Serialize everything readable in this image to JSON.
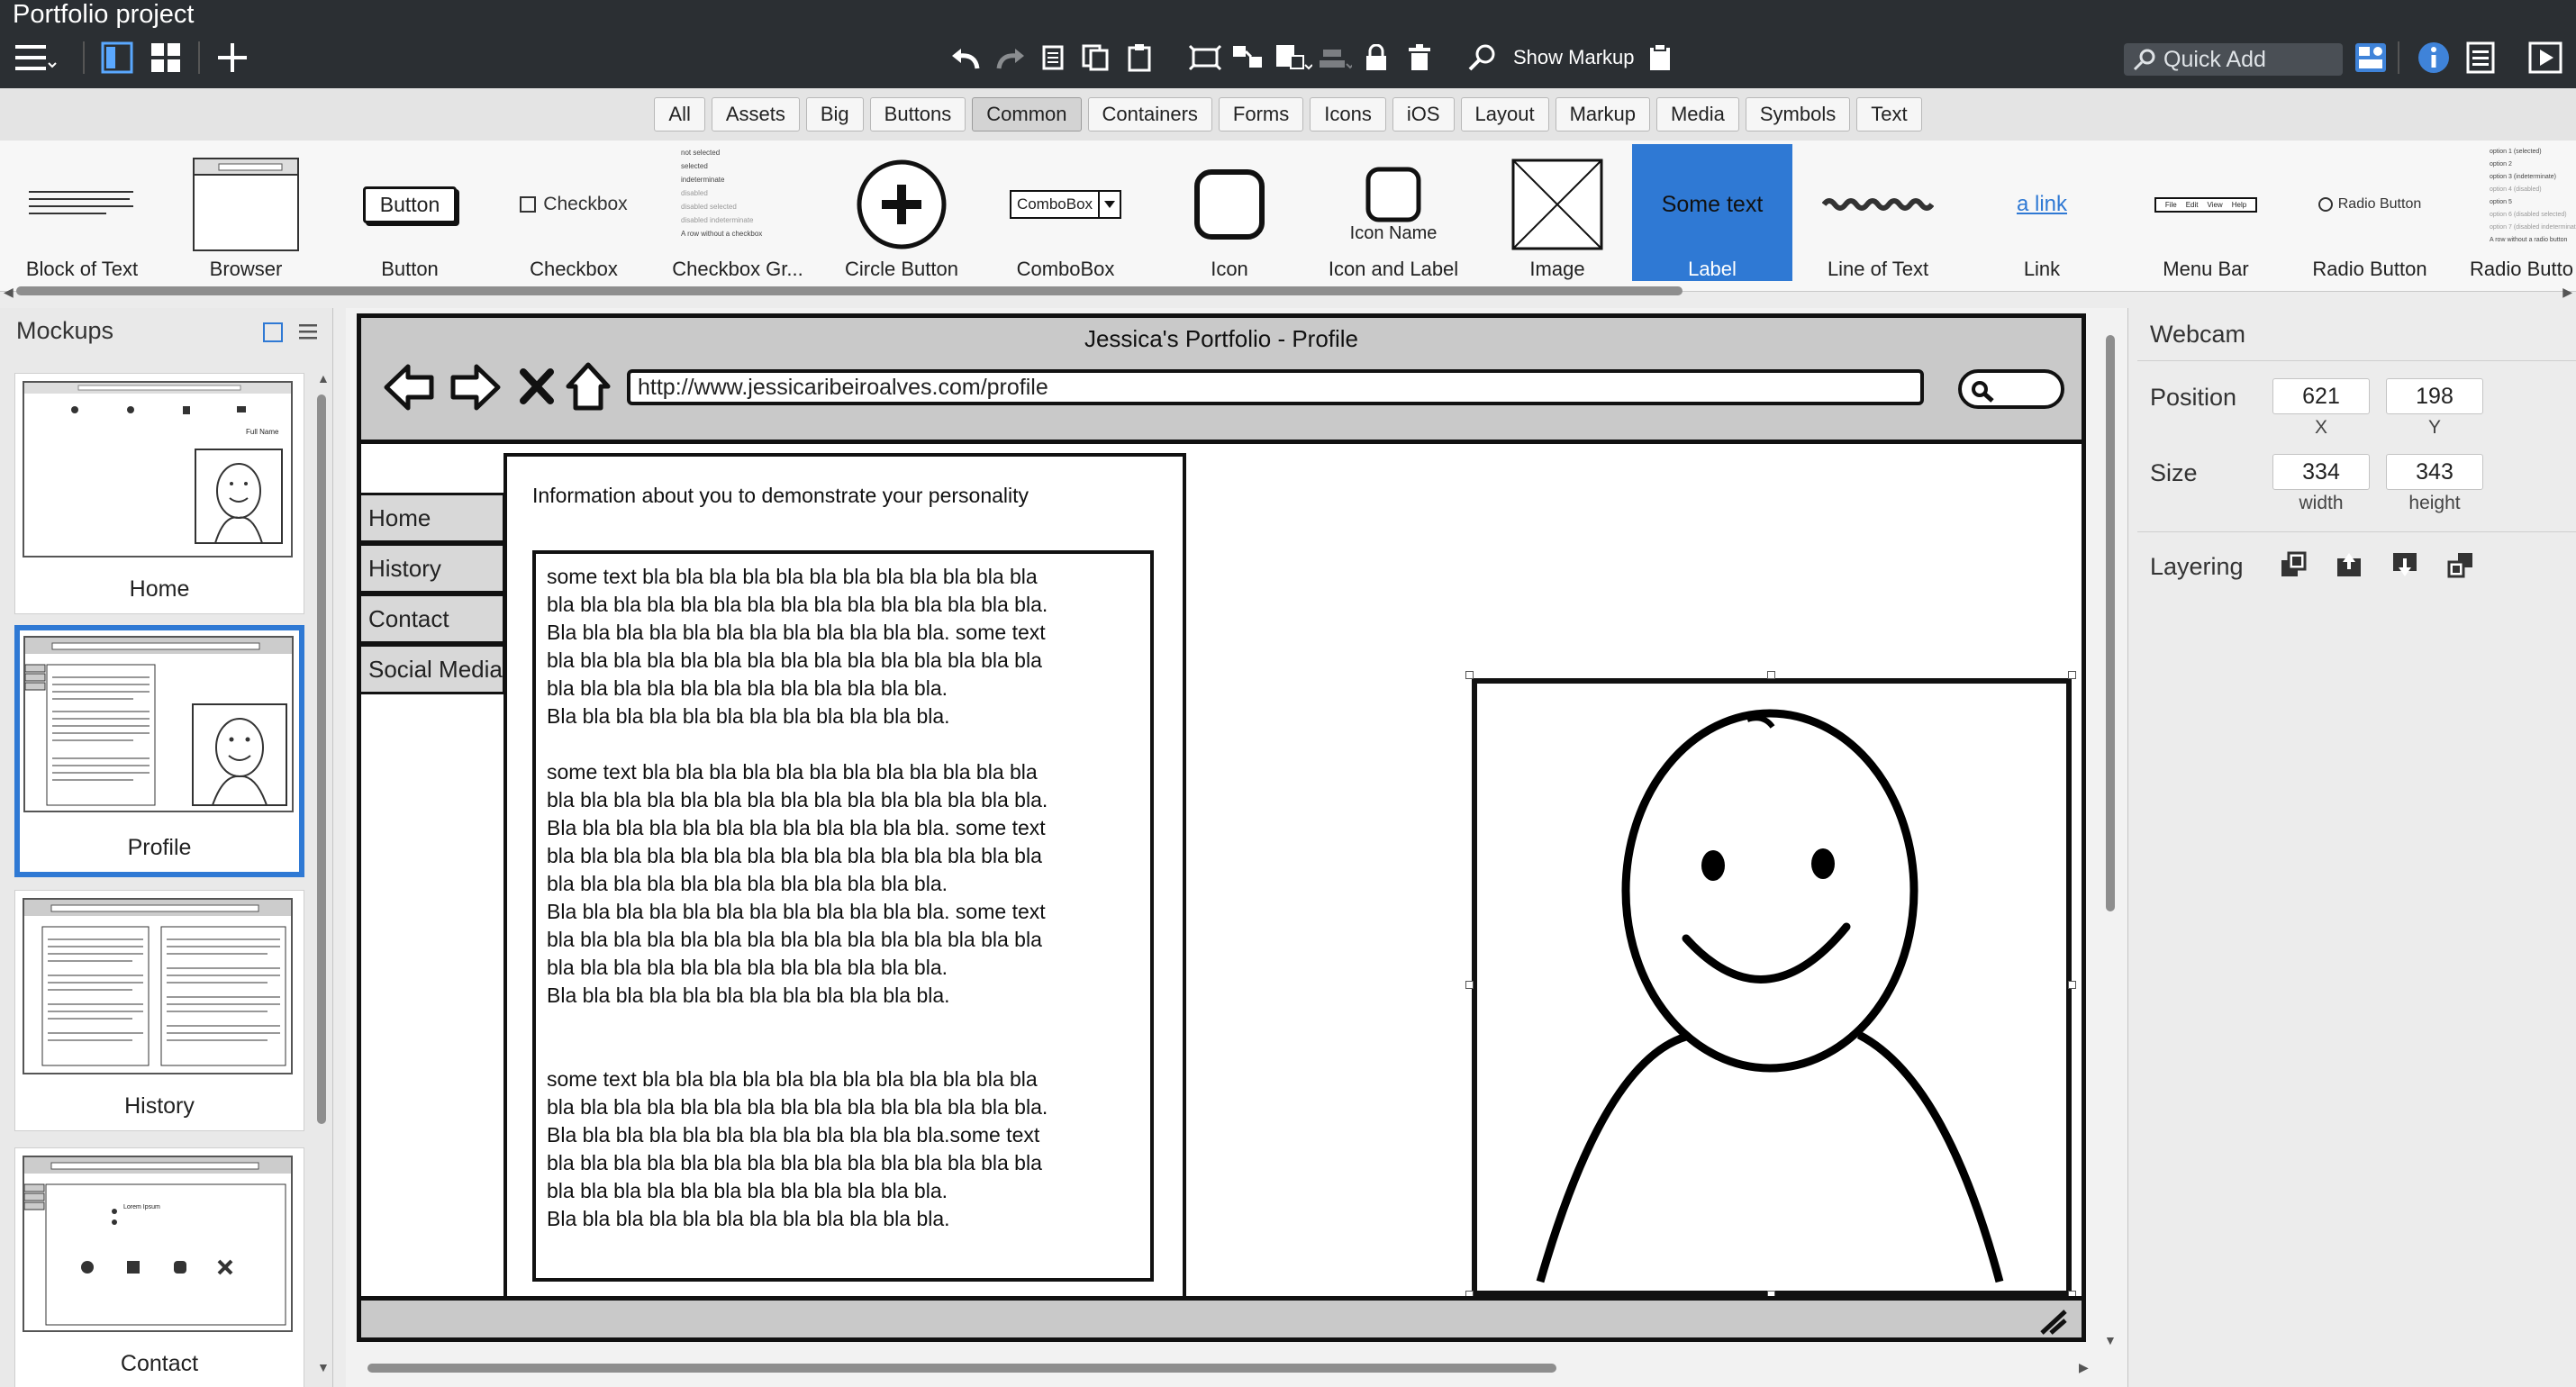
{
  "app": {
    "title": "Portfolio project"
  },
  "toolbar": {
    "show_markup_label": "Show Markup",
    "quick_add_placeholder": "Quick Add"
  },
  "category_tabs": [
    "All",
    "Assets",
    "Big",
    "Buttons",
    "Common",
    "Containers",
    "Forms",
    "Icons",
    "iOS",
    "Layout",
    "Markup",
    "Media",
    "Symbols",
    "Text"
  ],
  "active_category": "Common",
  "components": [
    {
      "label": "Block of Text"
    },
    {
      "label": "Browser"
    },
    {
      "label": "Button",
      "preview": "Button"
    },
    {
      "label": "Checkbox",
      "preview": "Checkbox"
    },
    {
      "label": "Checkbox Gr...",
      "preview_items": [
        "not selected",
        "selected",
        "indeterminate",
        "disabled",
        "disabled selected",
        "disabled indeterminate",
        "A row without a checkbox"
      ]
    },
    {
      "label": "Circle Button"
    },
    {
      "label": "ComboBox",
      "preview": "ComboBox"
    },
    {
      "label": "Icon"
    },
    {
      "label": "Icon and Label",
      "preview": "Icon Name"
    },
    {
      "label": "Image"
    },
    {
      "label": "Label",
      "preview": "Some text",
      "selected": true
    },
    {
      "label": "Line of Text"
    },
    {
      "label": "Link",
      "preview": "a link"
    },
    {
      "label": "Menu Bar",
      "preview_items": [
        "File",
        "Edit",
        "View",
        "Help"
      ]
    },
    {
      "label": "Radio Button",
      "preview": "Radio Button"
    },
    {
      "label": "Radio Butto",
      "preview_items": [
        "option 1 (selected)",
        "option 2",
        "option 3 (indeterminate)",
        "option 4 (disabled)",
        "option 5",
        "option 6 (disabled selected)",
        "option 7 (disabled indeterminate)",
        "A row without a radio button"
      ]
    }
  ],
  "mockups_panel": {
    "title": "Mockups",
    "items": [
      {
        "name": "Home",
        "thumb_text": "Full Name"
      },
      {
        "name": "Profile",
        "selected": true
      },
      {
        "name": "History"
      },
      {
        "name": "Contact",
        "thumb_text": "Lorem Ipsum"
      }
    ]
  },
  "mockup": {
    "window_title": "Jessica's Portfolio - Profile",
    "url": "http://www.jessicaribeiroalves.com/profile",
    "nav": [
      "Home",
      "History",
      "Contact",
      "Social Media"
    ],
    "heading": "Information about you to demonstrate your personality",
    "paragraphs": [
      "some text bla bla bla bla bla bla bla bla bla bla bla bla\nbla bla bla bla bla bla bla bla bla bla bla bla bla bla bla.\nBla bla bla bla bla bla bla bla bla bla bla bla. some text\nbla bla bla bla bla bla bla bla bla bla bla bla bla bla bla\nbla bla bla bla bla bla bla bla bla bla bla bla.\nBla bla bla bla bla bla bla bla bla bla bla bla.",
      "some text bla bla bla bla bla bla bla bla bla bla bla bla\nbla bla bla bla bla bla bla bla bla bla bla bla bla bla bla.\nBla bla bla bla bla bla bla bla bla bla bla bla. some text\nbla bla bla bla bla bla bla bla bla bla bla bla bla bla bla\nbla bla bla bla bla bla bla bla bla bla bla bla.\nBla bla bla bla bla bla bla bla bla bla bla bla. some text\nbla bla bla bla bla bla bla bla bla bla bla bla bla bla bla\nbla bla bla bla bla bla bla bla bla bla bla bla.\nBla bla bla bla bla bla bla bla bla bla bla bla.",
      "some text bla bla bla bla bla bla bla bla bla bla bla bla\nbla bla bla bla bla bla bla bla bla bla bla bla bla bla bla.\nBla bla bla bla bla bla bla bla bla bla bla bla.some text\nbla bla bla bla bla bla bla bla bla bla bla bla bla bla bla\nbla bla bla bla bla bla bla bla bla bla bla bla.\nBla bla bla bla bla bla bla bla bla bla bla bla."
    ]
  },
  "inspector": {
    "title": "Webcam",
    "position_label": "Position",
    "position": {
      "x": "621",
      "y": "198",
      "x_caption": "X",
      "y_caption": "Y"
    },
    "size_label": "Size",
    "size": {
      "width": "334",
      "height": "343",
      "width_caption": "width",
      "height_caption": "height"
    },
    "layering_label": "Layering"
  },
  "colors": {
    "toolbar_bg": "#2b2f33",
    "selection_blue": "#2f79d4",
    "sketch_ink": "#111111",
    "sketch_fill": "#c9c9c9"
  }
}
